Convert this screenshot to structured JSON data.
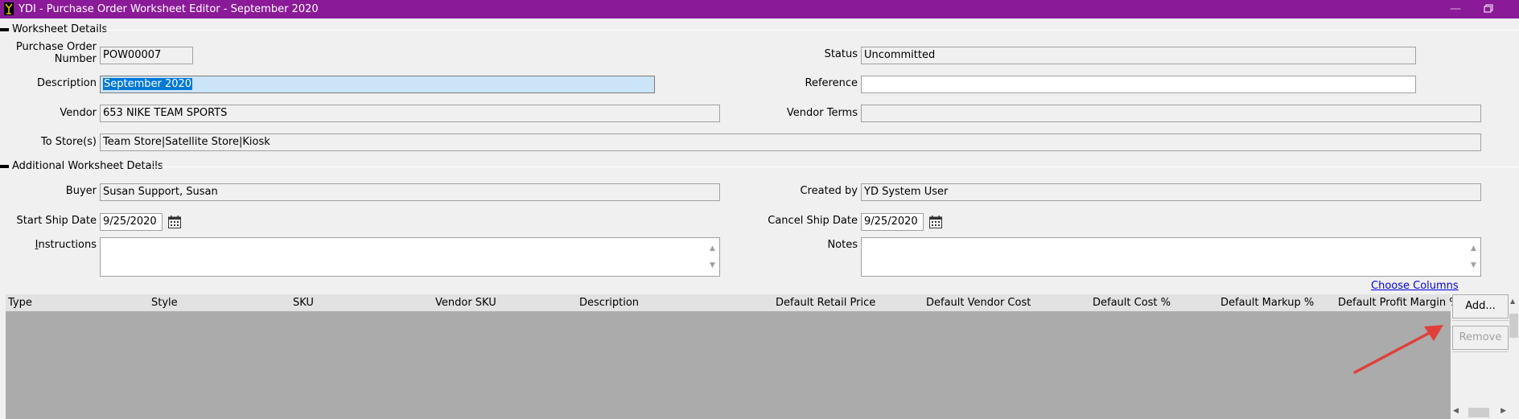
{
  "window": {
    "title": "YDI - Purchase Order Worksheet Editor - September 2020",
    "minimize_glyph": "—"
  },
  "sections": {
    "worksheet_details": "Worksheet Details",
    "additional_details": "Additional Worksheet Details"
  },
  "form": {
    "po_number": {
      "label_line1": "Purchase Order",
      "label_line2": "Number",
      "value": "POW00007"
    },
    "status": {
      "label": "Status",
      "value": "Uncommitted"
    },
    "description": {
      "label": "Description",
      "value": "September 2020"
    },
    "reference": {
      "label": "Reference",
      "value": ""
    },
    "vendor": {
      "label": "Vendor",
      "value": "653 NIKE TEAM SPORTS"
    },
    "vendor_terms": {
      "label": "Vendor Terms",
      "value": ""
    },
    "to_stores": {
      "label": "To Store(s)",
      "value": "Team Store|Satellite Store|Kiosk"
    },
    "buyer": {
      "label": "Buyer",
      "value": "Susan Support, Susan"
    },
    "created_by": {
      "label": "Created by",
      "value": "YD System User"
    },
    "start_ship_date": {
      "label": "Start Ship Date",
      "value": "9/25/2020"
    },
    "cancel_ship_date": {
      "label": "Cancel Ship Date",
      "value": "9/25/2020"
    },
    "instructions": {
      "label_first": "I",
      "label_rest": "nstructions",
      "value": ""
    },
    "notes": {
      "label": "Notes",
      "value": ""
    }
  },
  "grid": {
    "choose_columns": "Choose Columns",
    "columns": [
      "Type",
      "Style",
      "SKU",
      "Vendor SKU",
      "Description",
      "Default Retail Price",
      "Default Vendor Cost",
      "Default Cost %",
      "Default Markup %",
      "Default Profit Margin %"
    ],
    "rows": []
  },
  "buttons": {
    "add": "Add...",
    "remove": "Remove"
  },
  "colors": {
    "titlebar": "#8a1a98",
    "annotation_arrow": "#e0403a",
    "grid_body": "#ababab"
  }
}
